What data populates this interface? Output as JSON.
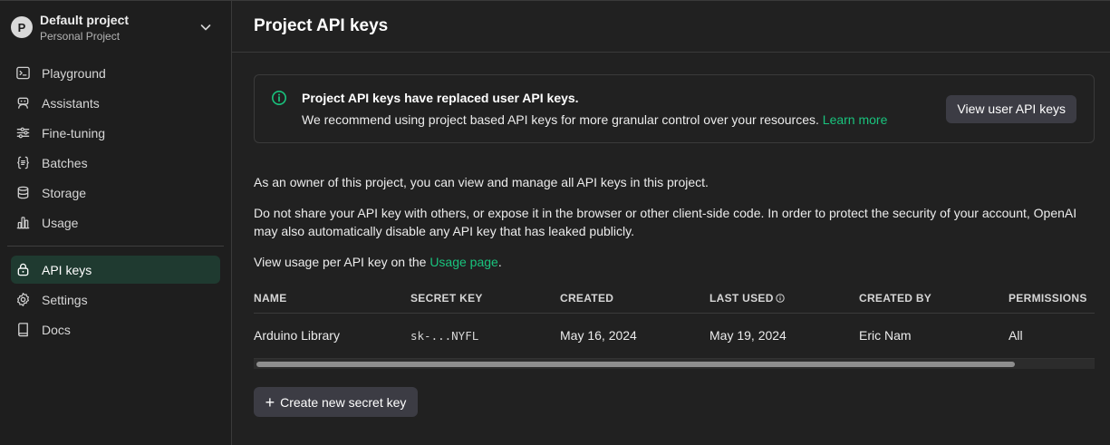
{
  "project": {
    "avatar_letter": "P",
    "name": "Default project",
    "subtitle": "Personal Project"
  },
  "nav": {
    "items": [
      {
        "label": "Playground",
        "icon": "terminal-icon"
      },
      {
        "label": "Assistants",
        "icon": "robot-icon"
      },
      {
        "label": "Fine-tuning",
        "icon": "sliders-icon"
      },
      {
        "label": "Batches",
        "icon": "braces-icon"
      },
      {
        "label": "Storage",
        "icon": "database-icon"
      },
      {
        "label": "Usage",
        "icon": "bar-chart-icon"
      }
    ],
    "bottom_items": [
      {
        "label": "API keys",
        "icon": "lock-icon",
        "active": true
      },
      {
        "label": "Settings",
        "icon": "gear-icon"
      },
      {
        "label": "Docs",
        "icon": "book-icon"
      }
    ]
  },
  "header": {
    "title": "Project API keys"
  },
  "banner": {
    "title": "Project API keys have replaced user API keys.",
    "body": "We recommend using project based API keys for more granular control over your resources.",
    "link": "Learn more",
    "button": "View user API keys"
  },
  "description": {
    "p1": "As an owner of this project, you can view and manage all API keys in this project.",
    "p2": "Do not share your API key with others, or expose it in the browser or other client-side code. In order to protect the security of your account, OpenAI may also automatically disable any API key that has leaked publicly.",
    "p3_prefix": "View usage per API key on the",
    "p3_link": "Usage page",
    "p3_suffix": "."
  },
  "table": {
    "headers": [
      "NAME",
      "SECRET KEY",
      "CREATED",
      "LAST USED",
      "CREATED BY",
      "PERMISSIONS"
    ],
    "rows": [
      {
        "name": "Arduino Library",
        "secret": "sk-...NYFL",
        "created": "May 16, 2024",
        "last_used": "May 19, 2024",
        "created_by": "Eric Nam",
        "permissions": "All"
      }
    ]
  },
  "actions": {
    "create_label": "Create new secret key"
  },
  "colors": {
    "accent": "#19c37d",
    "active_bg": "#1f3a30",
    "background": "#212121"
  }
}
